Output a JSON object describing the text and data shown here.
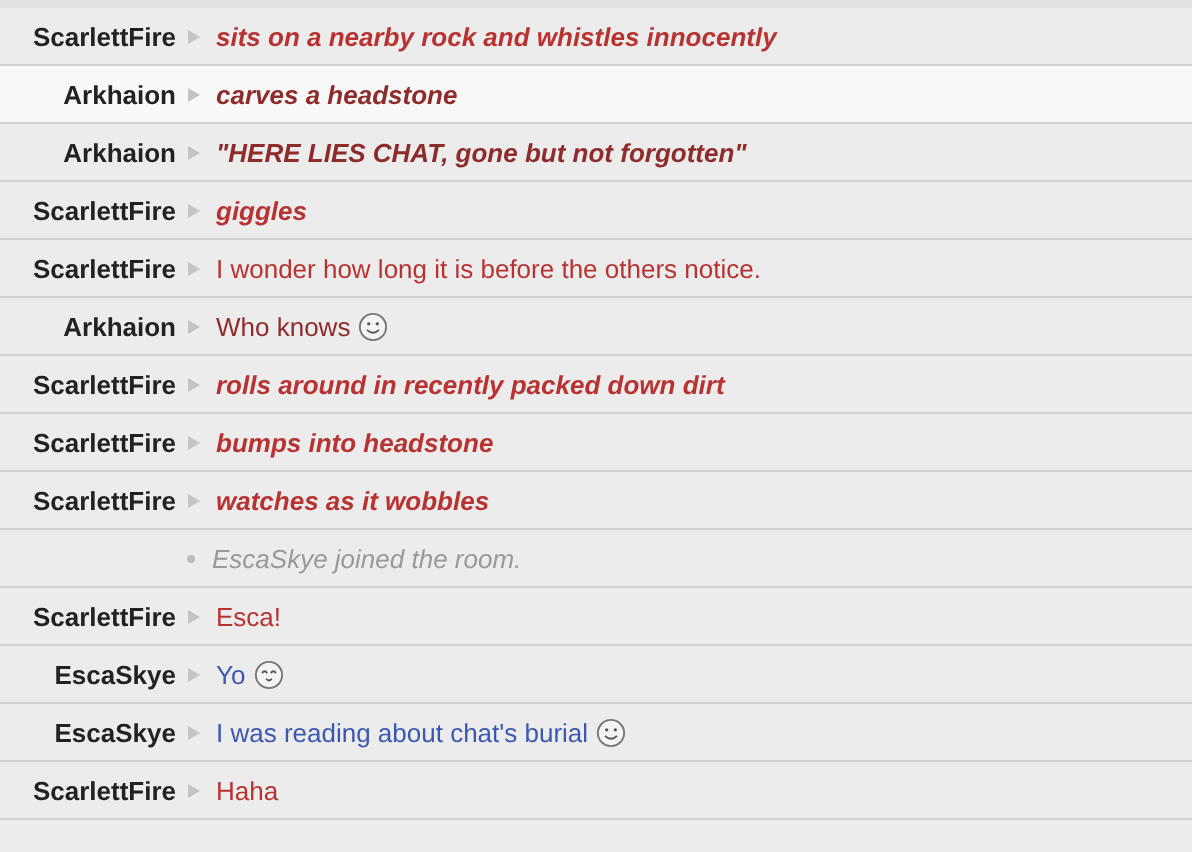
{
  "messages": [
    {
      "kind": "action",
      "author": "ScarlettFire",
      "text": "sits on a nearby rock and whistles innocently",
      "color": "#b83232"
    },
    {
      "kind": "action",
      "author": "Arkhaion",
      "text": "carves a headstone",
      "color": "#8e2b2b",
      "highlighted": true
    },
    {
      "kind": "action",
      "author": "Arkhaion",
      "text": "\"HERE LIES CHAT, gone but not forgotten\"",
      "color": "#8e2b2b"
    },
    {
      "kind": "action",
      "author": "ScarlettFire",
      "text": "giggles",
      "color": "#b83232"
    },
    {
      "kind": "say",
      "author": "ScarlettFire",
      "text": "I wonder how long it is before the others notice.",
      "color": "#b83232"
    },
    {
      "kind": "say",
      "author": "Arkhaion",
      "text": "Who knows",
      "color": "#8e2b2b",
      "emoticon": {
        "kind": "smile"
      }
    },
    {
      "kind": "action",
      "author": "ScarlettFire",
      "text": "rolls around in recently packed down dirt",
      "color": "#b83232"
    },
    {
      "kind": "action",
      "author": "ScarlettFire",
      "text": "bumps into headstone",
      "color": "#b83232"
    },
    {
      "kind": "action",
      "author": "ScarlettFire",
      "text": "watches as it wobbles",
      "color": "#b83232"
    },
    {
      "kind": "system",
      "text": "EscaSkye joined the room."
    },
    {
      "kind": "say",
      "author": "ScarlettFire",
      "text": "Esca!",
      "color": "#b83232"
    },
    {
      "kind": "say",
      "author": "EscaSkye",
      "text": "Yo",
      "color": "#3b57b0",
      "emoticon": {
        "kind": "happy"
      }
    },
    {
      "kind": "say",
      "author": "EscaSkye",
      "text": "I was reading about chat's burial",
      "color": "#3b57b0",
      "emoticon": {
        "kind": "smile"
      }
    },
    {
      "kind": "say",
      "author": "ScarlettFire",
      "text": "Haha",
      "color": "#b83232"
    }
  ]
}
